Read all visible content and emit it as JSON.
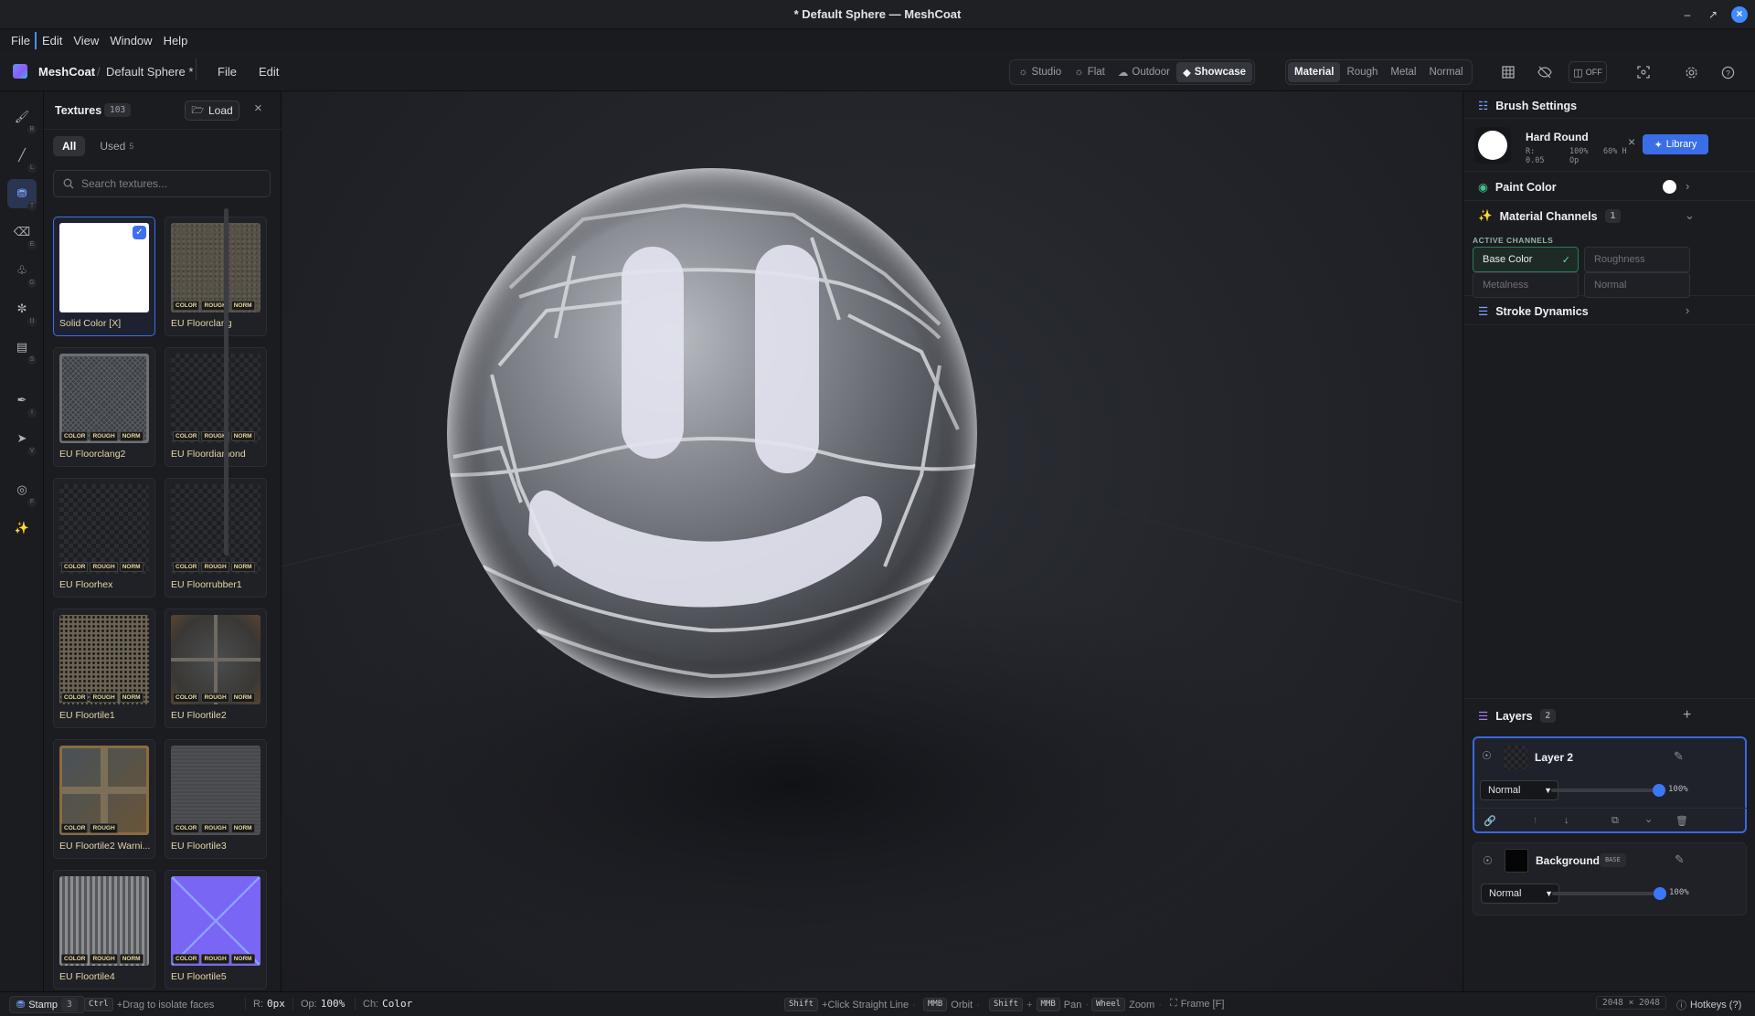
{
  "window": {
    "title": "* Default Sphere — MeshCoat"
  },
  "menubar": [
    "File",
    "Edit",
    "View",
    "Window",
    "Help"
  ],
  "appbar": {
    "app_name": "MeshCoat",
    "doc_name": "Default Sphere *",
    "menu": [
      "File",
      "Edit"
    ],
    "env_modes": [
      {
        "label": "Studio",
        "icon": "sun-icon",
        "active": false
      },
      {
        "label": "Flat",
        "icon": "flat-light-icon",
        "active": false
      },
      {
        "label": "Outdoor",
        "icon": "cloud-sun-icon",
        "active": false
      },
      {
        "label": "Showcase",
        "icon": "gem-icon",
        "active": true
      }
    ],
    "view_modes": [
      {
        "label": "Material",
        "active": true
      },
      {
        "label": "Rough",
        "active": false
      },
      {
        "label": "Metal",
        "active": false
      },
      {
        "label": "Normal",
        "active": false
      }
    ],
    "mirror_label": "OFF"
  },
  "tools": [
    {
      "name": "brush",
      "key": "B",
      "active": false
    },
    {
      "name": "line",
      "key": "L",
      "active": false
    },
    {
      "name": "stamp",
      "key": "T",
      "active": true
    },
    {
      "name": "eraser",
      "key": "E",
      "active": false
    },
    {
      "name": "fill",
      "key": "G",
      "active": false
    },
    {
      "name": "smudge",
      "key": "U",
      "active": false
    },
    {
      "name": "decal",
      "key": "S",
      "active": false
    },
    {
      "name": "eyedropper",
      "key": "I",
      "active": false
    },
    {
      "name": "select",
      "key": "V",
      "active": false
    },
    {
      "name": "frame",
      "key": "F",
      "active": false
    },
    {
      "name": "effects",
      "key": "",
      "active": false
    }
  ],
  "textures": {
    "title": "Textures",
    "count": "103",
    "load_label": "Load",
    "tabs": [
      {
        "label": "All",
        "count": "",
        "active": true
      },
      {
        "label": "Used",
        "count": "5",
        "active": false
      }
    ],
    "search_placeholder": "Search textures...",
    "items": [
      {
        "name": "Solid Color [X]",
        "style": "solid",
        "selected": true,
        "tags": []
      },
      {
        "name": "EU Floorclang",
        "style": "gravel",
        "selected": false,
        "tags": [
          "COLOR",
          "ROUGH",
          "NORM"
        ]
      },
      {
        "name": "EU Floorclang2",
        "style": "grate",
        "selected": false,
        "tags": [
          "COLOR",
          "ROUGH",
          "NORM"
        ]
      },
      {
        "name": "EU Floordiamond",
        "style": "checker",
        "selected": false,
        "tags": [
          "COLOR",
          "ROUGH",
          "NORM"
        ]
      },
      {
        "name": "EU Floorhex",
        "style": "checker",
        "selected": false,
        "tags": [
          "COLOR",
          "ROUGH",
          "NORM"
        ]
      },
      {
        "name": "EU Floorrubber1",
        "style": "checker",
        "selected": false,
        "tags": [
          "COLOR",
          "ROUGH",
          "NORM"
        ]
      },
      {
        "name": "EU Floortile1",
        "style": "perforated",
        "selected": false,
        "tags": [
          "COLOR",
          "ROUGH",
          "NORM"
        ]
      },
      {
        "name": "EU Floortile2",
        "style": "rusttile",
        "selected": false,
        "tags": [
          "COLOR",
          "ROUGH",
          "NORM"
        ]
      },
      {
        "name": "EU Floortile2 Warni...",
        "style": "warning",
        "selected": false,
        "tags": [
          "COLOR",
          "ROUGH"
        ]
      },
      {
        "name": "EU Floortile3",
        "style": "gray",
        "selected": false,
        "tags": [
          "COLOR",
          "ROUGH",
          "NORM"
        ]
      },
      {
        "name": "EU Floortile4",
        "style": "slats",
        "selected": false,
        "tags": [
          "COLOR",
          "ROUGH",
          "NORM"
        ]
      },
      {
        "name": "EU Floortile5",
        "style": "normal",
        "selected": false,
        "tags": [
          "COLOR",
          "ROUGH",
          "NORM"
        ]
      }
    ]
  },
  "brush": {
    "section_title": "Brush Settings",
    "name": "Hard Round",
    "params": [
      "R: 0.05",
      "100% Op",
      "60% H"
    ],
    "library_label": "Library"
  },
  "paint_color": {
    "label": "Paint Color",
    "value": "#ffffff"
  },
  "material_channels": {
    "label": "Material Channels",
    "count": "1",
    "active_label": "ACTIVE CHANNELS",
    "channels": [
      {
        "label": "Base Color",
        "active": true
      },
      {
        "label": "Roughness",
        "active": false
      },
      {
        "label": "Metalness",
        "active": false
      },
      {
        "label": "Normal",
        "active": false
      }
    ]
  },
  "stroke_dynamics": {
    "label": "Stroke Dynamics"
  },
  "layers": {
    "label": "Layers",
    "count": "2",
    "items": [
      {
        "name": "Layer 2",
        "blend": "Normal",
        "opacity": "100%",
        "opacity_value": 1.0,
        "active": true,
        "badge": ""
      },
      {
        "name": "Background",
        "blend": "Normal",
        "opacity": "100%",
        "opacity_value": 1.0,
        "active": false,
        "badge": "BASE"
      }
    ]
  },
  "status": {
    "tool": "Stamp",
    "tool_key": "3",
    "hint_key": "Ctrl",
    "hint": "+Drag to isolate faces",
    "radius_label": "R:",
    "radius": "0px",
    "opacity_label": "Op:",
    "opacity": "100%",
    "channel_label": "Ch:",
    "channel": "Color",
    "nav": [
      {
        "keys": [
          "Shift"
        ],
        "text": "+Click Straight Line"
      },
      {
        "keys": [
          "MMB"
        ],
        "text": "Orbit"
      },
      {
        "keys": [
          "Shift",
          "MMB"
        ],
        "text": "Pan"
      },
      {
        "keys": [
          "Wheel"
        ],
        "text": "Zoom"
      }
    ],
    "frame": "Frame [F]",
    "resolution": "2048 × 2048",
    "hotkeys": "Hotkeys (?)"
  },
  "colors": {
    "accent": "#3a78f5",
    "active_channel": "#2c7a5e",
    "texture_label": "#e3d6a8"
  }
}
